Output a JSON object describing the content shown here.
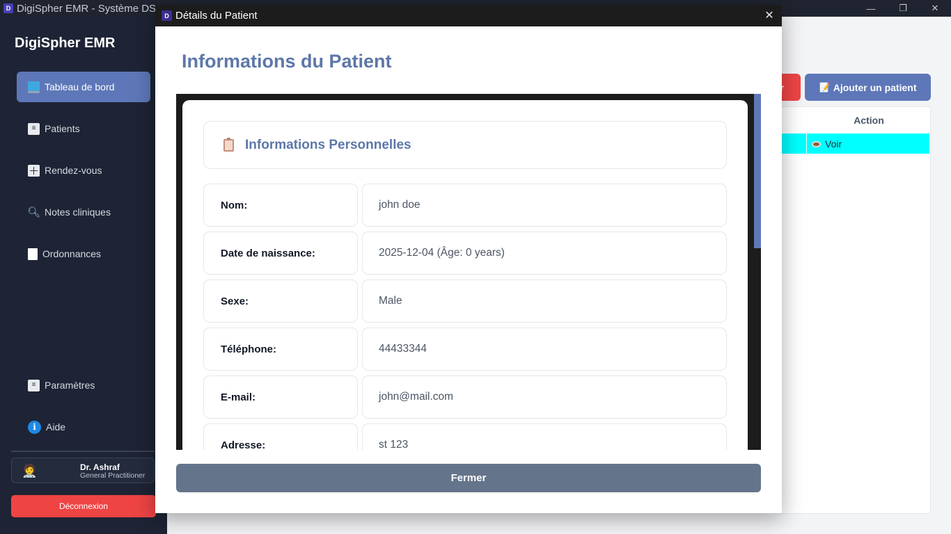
{
  "window": {
    "title": "DigiSpher EMR - Système DS",
    "icon_letter": "D",
    "minimize": "—",
    "maximize": "❐",
    "close": "✕"
  },
  "sidebar": {
    "brand": "DigiSpher EMR",
    "items": [
      {
        "label": "Tableau de bord",
        "icon": "monitor-icon",
        "active": true
      },
      {
        "label": "Patients",
        "icon": "list-icon"
      },
      {
        "label": "Rendez-vous",
        "icon": "grid-icon"
      },
      {
        "label": "Notes cliniques",
        "icon": "search-icon"
      },
      {
        "label": "Ordonnances",
        "icon": "document-icon"
      }
    ],
    "bottom_items": [
      {
        "label": "Paramètres",
        "icon": "list-icon"
      },
      {
        "label": "Aide",
        "icon": "info-icon"
      }
    ],
    "user": {
      "name": "Dr. Ashraf",
      "role": "General Practitioner"
    },
    "logout_label": "Déconnexion"
  },
  "main": {
    "red_button_fragment": "r",
    "add_patient_label": "Ajouter un patient",
    "table": {
      "action_header": "Action",
      "row_action": "Voir"
    }
  },
  "modal": {
    "title": "Détails du Patient",
    "icon_letter": "D",
    "close_glyph": "✕",
    "heading": "Informations du Patient",
    "section_title": "Informations Personnelles",
    "fields": [
      {
        "label": "Nom:",
        "value": "john doe"
      },
      {
        "label": "Date de naissance:",
        "value": "2025-12-04 (Âge: 0 years)"
      },
      {
        "label": "Sexe:",
        "value": "Male"
      },
      {
        "label": "Téléphone:",
        "value": "44433344"
      },
      {
        "label": "E-mail:",
        "value": "john@mail.com"
      },
      {
        "label": "Adresse:",
        "value": "st 123"
      }
    ],
    "close_button": "Fermer"
  },
  "colors": {
    "accent": "#5d77b8",
    "sidebar_bg": "#1e2435",
    "danger": "#ef4444",
    "highlight_row": "#00ffff",
    "close_button": "#64748b"
  }
}
